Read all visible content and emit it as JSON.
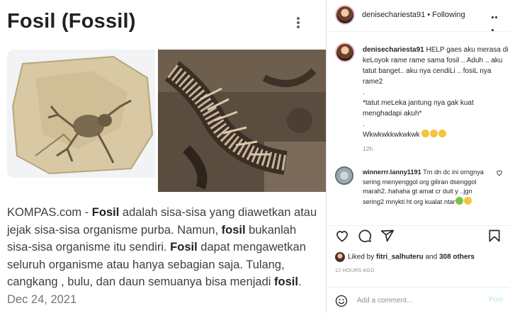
{
  "search_result": {
    "title": "Fosil (Fossil)",
    "source": "KOMPAS.com - ",
    "k1": "Fosil",
    "t1": " adalah sisa-sisa yang diawetkan atau jejak sisa-sisa organisme purba. Namun, ",
    "k2": "fosil",
    "t2": " bukanlah sisa-sisa organisme itu sendiri. ",
    "k3": "Fosil",
    "t3": " dapat mengawetkan seluruh organisme atau hanya sebagian saja. Tulang, cangkang , bulu, dan daun semuanya bisa menjadi ",
    "k4": "fosil",
    "t4": ".",
    "date": "Dec 24, 2021"
  },
  "header": {
    "username": "denisechariesta91",
    "separator": "•",
    "follow_status": "Following"
  },
  "caption": {
    "username": "denisechariesta91",
    "line1": " HELP gaes aku merasa di keLoyok rame rame sama fosil .. Aduh .. aku tatut banget.. aku nya cendiLi .. fosiL nya rame2",
    "line2": ".",
    "line3": "*tatut meLeka jantung nya gak kuat menghadapi akuh*",
    "line4": ".",
    "line5": "Wkwkwkkwkwkwk",
    "time": "12h"
  },
  "comment": {
    "username": "winnerrr.lanny1191",
    "text": " Tm dn dc ini orngnya sering menyenggol org giliran dsenggol marah2..hahaha gt amat cr duit y ..jgn sering2 mnykti ht org kualat ntar"
  },
  "likes": {
    "prefix": "Liked by ",
    "user": "fitri_salhuteru",
    "middle": " and ",
    "others": "308 others"
  },
  "posted": "12 HOURS AGO",
  "add_comment": {
    "placeholder": "Add a comment...",
    "post_label": "Post"
  },
  "colors": {
    "link_blue": "#b2dffc",
    "muted": "#8e8e8e"
  }
}
